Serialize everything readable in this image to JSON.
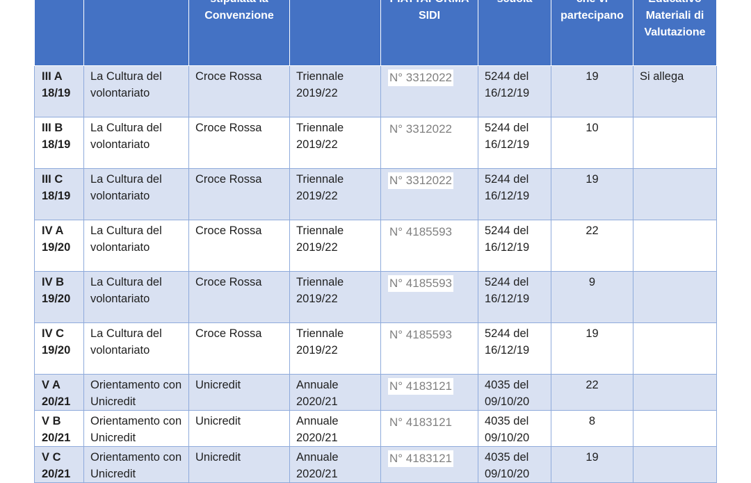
{
  "headers": [
    "",
    "",
    "stipulata la Convenzione",
    "",
    "PIATTAFORMA SIDI",
    "scuola",
    "che vi partecipano",
    "Educativo Materiali di Valutazione"
  ],
  "rows": [
    {
      "classe": "III A 18/19",
      "percorso": "La Cultura del volontariato",
      "ente": "Croce Rossa",
      "durata": "Triennale 2019/22",
      "sidi": "N° 3312022",
      "delibera": "5244 del 16/12/19",
      "studenti": "19",
      "materiali": "Si allega"
    },
    {
      "classe": "III B 18/19",
      "percorso": "La Cultura del volontariato",
      "ente": "Croce Rossa",
      "durata": "Triennale 2019/22",
      "sidi": "N° 3312022",
      "delibera": "5244 del 16/12/19",
      "studenti": "10",
      "materiali": ""
    },
    {
      "classe": "III C 18/19",
      "percorso": "La Cultura del volontariato",
      "ente": "Croce Rossa",
      "durata": "Triennale 2019/22",
      "sidi": "N° 3312022",
      "delibera": "5244 del 16/12/19",
      "studenti": "19",
      "materiali": ""
    },
    {
      "classe": "IV A 19/20",
      "percorso": "La Cultura del volontariato",
      "ente": "Croce Rossa",
      "durata": "Triennale 2019/22",
      "sidi": "N° 4185593",
      "delibera": "5244 del 16/12/19",
      "studenti": "22",
      "materiali": ""
    },
    {
      "classe": "IV B 19/20",
      "percorso": "La Cultura del volontariato",
      "ente": "Croce Rossa",
      "durata": "Triennale 2019/22",
      "sidi": "N° 4185593",
      "delibera": "5244 del 16/12/19",
      "studenti": "9",
      "materiali": ""
    },
    {
      "classe": "IV C 19/20",
      "percorso": "La Cultura del volontariato",
      "ente": "Croce Rossa",
      "durata": "Triennale 2019/22",
      "sidi": "N° 4185593",
      "delibera": "5244 del 16/12/19",
      "studenti": "19",
      "materiali": ""
    },
    {
      "classe": "V A 20/21",
      "percorso": "Orientamento con Unicredit",
      "ente": "Unicredit",
      "durata": "Annuale 2020/21",
      "sidi": "N° 4183121",
      "delibera": "4035 del 09/10/20",
      "studenti": "22",
      "materiali": ""
    },
    {
      "classe": "V B 20/21",
      "percorso": "Orientamento con Unicredit",
      "ente": "Unicredit",
      "durata": "Annuale 2020/21",
      "sidi": "N° 4183121",
      "delibera": "4035 del 09/10/20",
      "studenti": "8",
      "materiali": ""
    },
    {
      "classe": "V C 20/21",
      "percorso": "Orientamento con Unicredit",
      "ente": "Unicredit",
      "durata": "Annuale 2020/21",
      "sidi": "N° 4183121",
      "delibera": "4035 del 09/10/20",
      "studenti": "19",
      "materiali": ""
    }
  ]
}
